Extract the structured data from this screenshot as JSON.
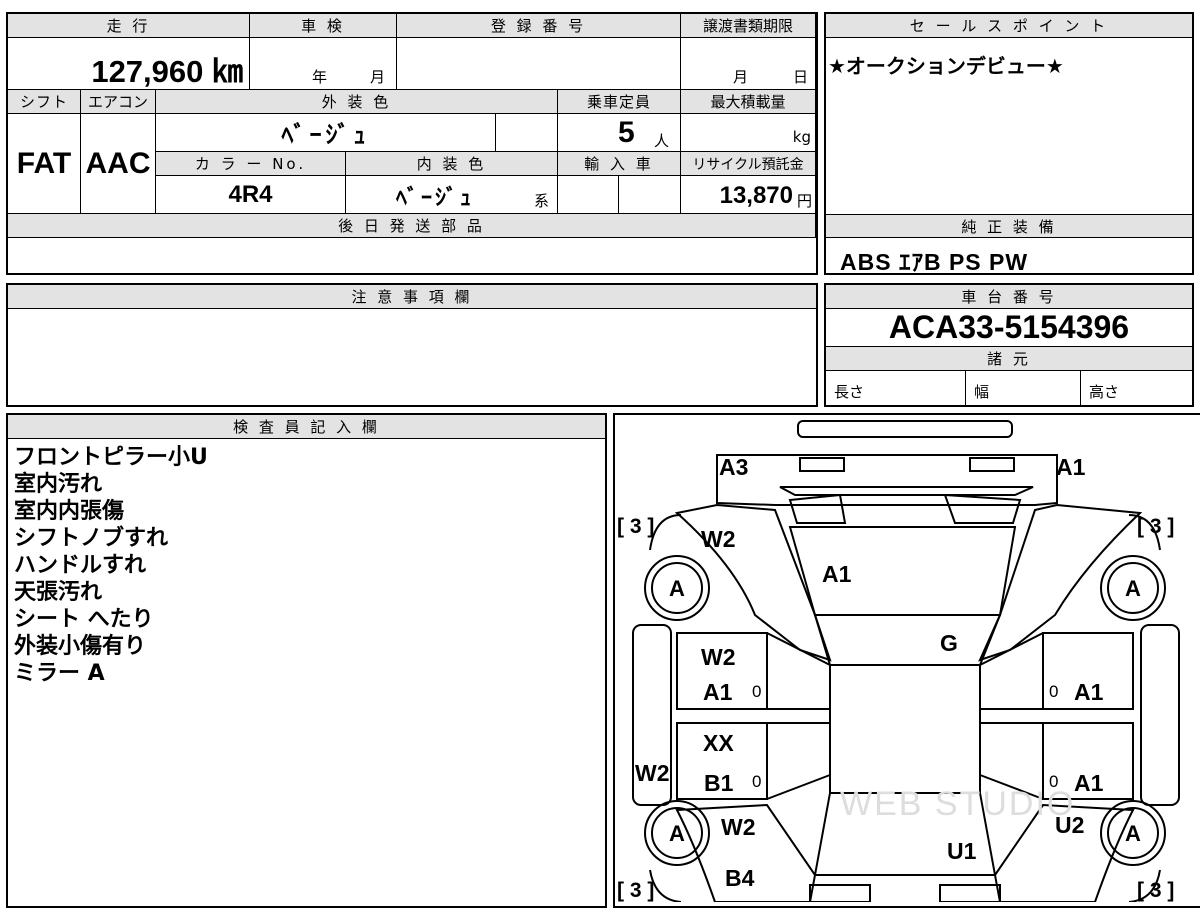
{
  "labels": {
    "mileage": "走 行",
    "inspection": "車 検",
    "registration_no": "登 録 番 号",
    "transfer_deadline": "譲渡書類期限",
    "shift": "シフト",
    "aircon": "エアコン",
    "exterior_color": "外 装 色",
    "capacity": "乗車定員",
    "max_load": "最大積載量",
    "color_no": "カ ラ ー No.",
    "interior_color": "内 装 色",
    "import": "輸 入 車",
    "recycle_fee": "リサイクル預託金",
    "later_parts": "後 日 発 送 部 品",
    "sales_point": "セ ー ル ス ポ イ ン ト",
    "standard_equipment": "純 正 装 備",
    "notes": "注 意 事 項 欄",
    "chassis_no": "車 台 番 号",
    "specs": "諸 元",
    "length": "長さ",
    "width": "幅",
    "height": "高さ",
    "inspector": "検 査 員 記 入 欄"
  },
  "vehicle": {
    "mileage": "127,960 ㎞",
    "inspection_year_unit": "年",
    "inspection_month_unit": "月",
    "transfer_month_unit": "月",
    "transfer_day_unit": "日",
    "shift": "FAT",
    "aircon": "AAC",
    "exterior_color": "ﾍﾞｰｼﾞｭ",
    "capacity": "5",
    "capacity_unit": "人",
    "max_load_unit": "kg",
    "color_no": "4R4",
    "interior_color": "ﾍﾞｰｼﾞｭ",
    "interior_suffix": "系",
    "recycle_fee": "13,870",
    "recycle_unit": "円",
    "sales_point": "★オークションデビュー★",
    "standard_equipment": "ABS ｴｱB PS PW",
    "chassis_no": "ACA33-5154396"
  },
  "inspector_notes": [
    "フロントピラー小U",
    "室内汚れ",
    "室内内張傷",
    "シフトノブすれ",
    "ハンドルすれ",
    "天張汚れ",
    "シート へたり",
    "外装小傷有り",
    "ミラー A"
  ],
  "diagram": {
    "tire_bracket": "[ 3 ]",
    "tire_grade": "A",
    "zero": "0",
    "marks": [
      "A3",
      "A1",
      "W2",
      "A1",
      "G",
      "W2",
      "A1",
      "XX",
      "B1",
      "W2",
      "W2",
      "B4",
      "U1",
      "U2",
      "A1",
      "A1"
    ],
    "watermark": "WEB STUDIO"
  }
}
